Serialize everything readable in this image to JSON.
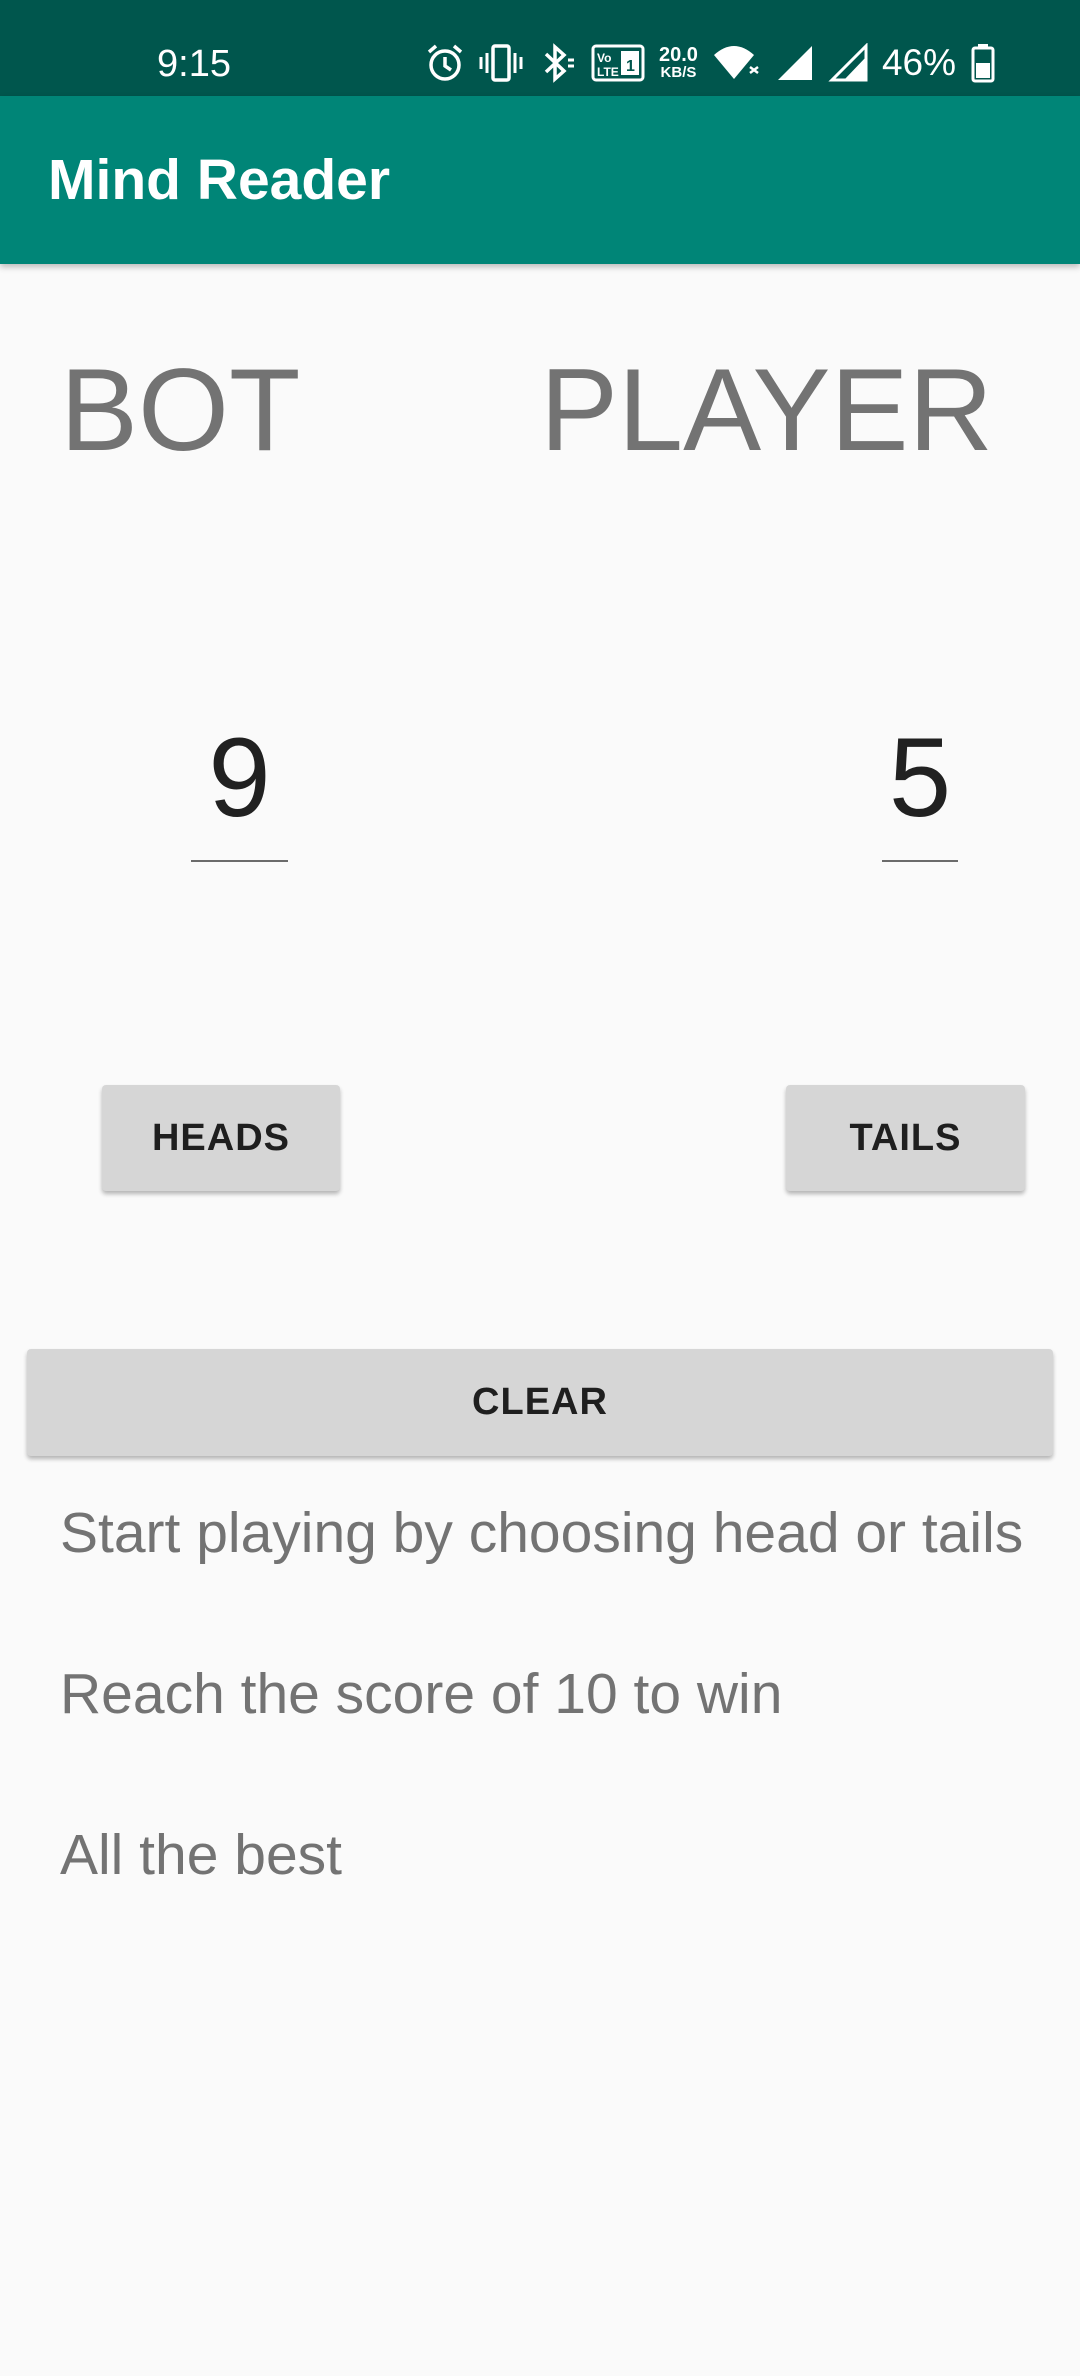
{
  "status_bar": {
    "time": "9:15",
    "icons": [
      "alarm-icon",
      "vibrate-icon",
      "bluetooth-icon",
      "volte-icon",
      "wifi-icon",
      "signal-icon",
      "signal-icon-2",
      "battery-icon"
    ],
    "net_speed_value": "20.0",
    "net_speed_unit": "KB/S",
    "volte_label": "Vo LTE 1",
    "battery": "46%"
  },
  "app_bar": {
    "title": "Mind Reader",
    "color": "#008577"
  },
  "game": {
    "bot_label": "BOT",
    "player_label": "PLAYER",
    "bot_score": "9",
    "player_score": "5"
  },
  "buttons": {
    "heads": "HEADS",
    "tails": "TAILS",
    "clear": "CLEAR"
  },
  "info": {
    "line1": "Start playing by choosing head or tails",
    "line2": "Reach the score of 10 to win",
    "line3": "All the best"
  },
  "colors": {
    "status_bar": "#00564d",
    "accent": "#008577",
    "background": "#fafafa",
    "button": "#d6d6d6"
  }
}
